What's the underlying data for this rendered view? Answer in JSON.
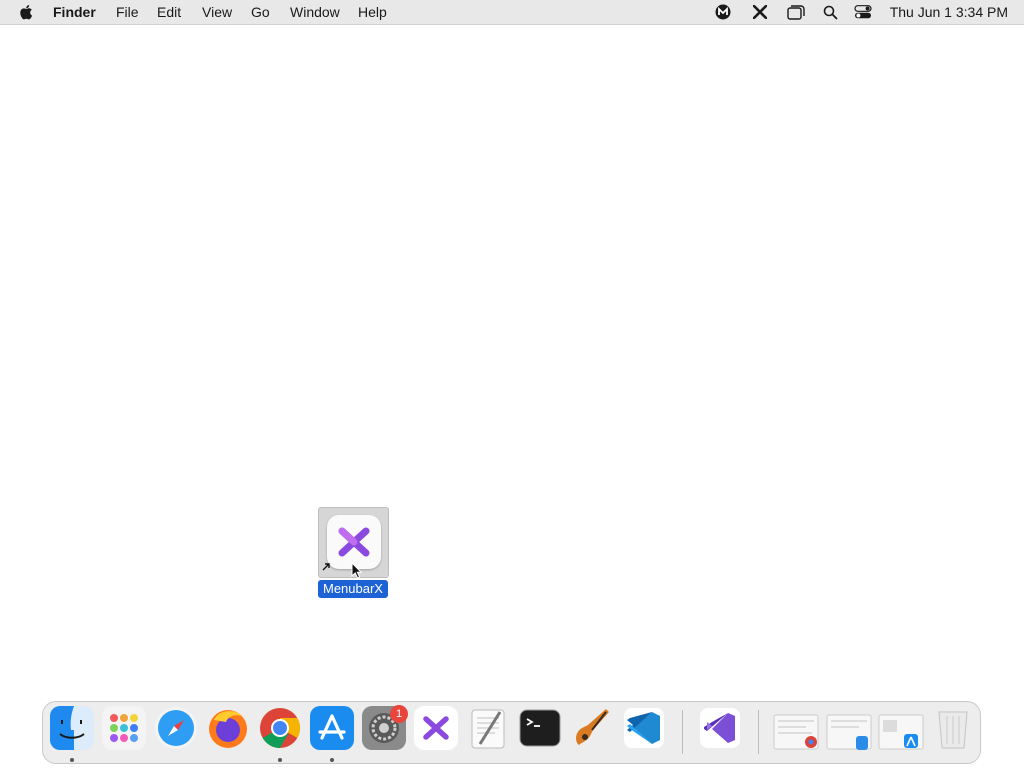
{
  "menubar": {
    "app_name": "Finder",
    "menus": [
      "File",
      "Edit",
      "View",
      "Go",
      "Window",
      "Help"
    ],
    "clock": "Thu Jun 1  3:34 PM",
    "status_icons": [
      "malwarebytes-icon",
      "menubarx-icon",
      "window-icon",
      "search-icon",
      "control-center-icon"
    ]
  },
  "desktop": {
    "icon_label": "MenubarX"
  },
  "dock": {
    "apps": [
      "Finder",
      "Launchpad",
      "Safari",
      "Firefox",
      "Google Chrome",
      "App Store",
      "System Preferences",
      "MenubarX",
      "TextEdit",
      "Terminal",
      "GarageBand",
      "Visual Studio Code",
      "Visual Studio"
    ],
    "badge_count": "1",
    "stacks": [
      "Downloads stack",
      "Documents stack",
      "Applications stack"
    ],
    "trash": "Trash"
  }
}
